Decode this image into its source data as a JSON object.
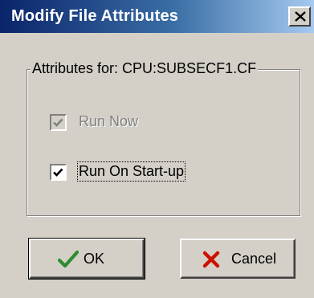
{
  "window": {
    "title": "Modify File Attributes",
    "close_symbol": "X"
  },
  "group": {
    "legend": "Attributes for: CPU:SUBSECF1.CF"
  },
  "options": [
    {
      "label": "Run Now",
      "checked": true,
      "enabled": false
    },
    {
      "label": "Run On Start-up",
      "checked": true,
      "enabled": true
    }
  ],
  "buttons": {
    "ok_label": "OK",
    "cancel_label": "Cancel"
  },
  "icons": {
    "ok": "checkmark-icon",
    "cancel": "x-icon",
    "close": "close-icon"
  },
  "colors": {
    "titlebar_start": "#0a246a",
    "titlebar_end": "#a6caf0",
    "face": "#d4d0c8",
    "ok_check": "#2e8b2e",
    "cancel_x": "#cc1100"
  }
}
